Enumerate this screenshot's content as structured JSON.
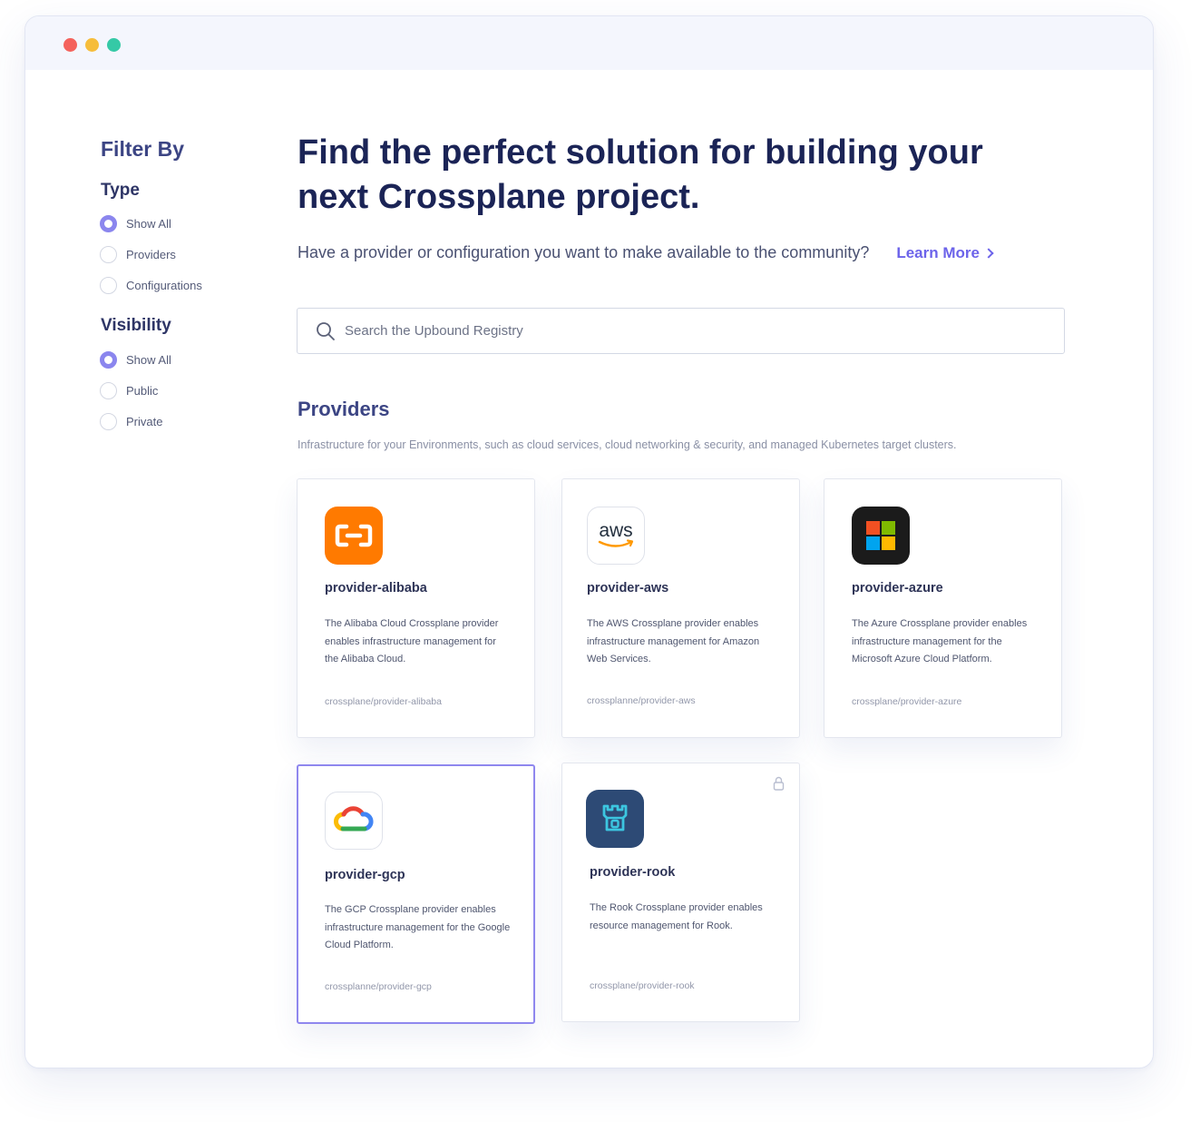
{
  "window": {
    "controls": [
      "close",
      "minimize",
      "maximize"
    ]
  },
  "filters": {
    "title": "Filter By",
    "type": {
      "title": "Type",
      "options": [
        {
          "label": "Show All",
          "checked": true
        },
        {
          "label": "Providers",
          "checked": false
        },
        {
          "label": "Configurations",
          "checked": false
        }
      ]
    },
    "visibility": {
      "title": "Visibility",
      "options": [
        {
          "label": "Show All",
          "checked": true
        },
        {
          "label": "Public",
          "checked": false
        },
        {
          "label": "Private",
          "checked": false
        }
      ]
    }
  },
  "main": {
    "headline": "Find the perfect solution for building your next Crossplane project.",
    "subtext": "Have a provider or configuration you want to make available to the community?",
    "learn_more": "Learn More",
    "search": {
      "placeholder": "Search the Upbound Registry",
      "value": ""
    },
    "section": {
      "title": "Providers",
      "description": "Infrastructure for your Environments, such as cloud services, cloud networking & security, and managed Kubernetes target clusters."
    },
    "cards": [
      {
        "name": "provider-alibaba",
        "description": "The Alibaba Cloud Crossplane provider enables infrastructure management for the Alibaba Cloud.",
        "path": "crossplane/provider-alibaba",
        "icon": "alibaba-cloud-logo",
        "selected": false,
        "locked": false
      },
      {
        "name": "provider-aws",
        "description": "The AWS Crossplane provider enables infrastructure management for Amazon Web Services.",
        "path": "crossplanne/provider-aws",
        "icon": "aws-logo",
        "logo_text": "aws",
        "selected": false,
        "locked": false
      },
      {
        "name": "provider-azure",
        "description": "The Azure Crossplane provider enables infrastructure management for the Microsoft Azure Cloud Platform.",
        "path": "crossplane/provider-azure",
        "icon": "microsoft-azure-logo",
        "selected": false,
        "locked": false
      },
      {
        "name": "provider-gcp",
        "description": "The GCP Crossplane provider enables infrastructure management for the Google Cloud Platform.",
        "path": "crossplanne/provider-gcp",
        "icon": "google-cloud-logo",
        "selected": true,
        "locked": false
      },
      {
        "name": "provider-rook",
        "description": "The Rook Crossplane provider enables resource management for Rook.",
        "path": "crossplane/provider-rook",
        "icon": "rook-logo",
        "selected": false,
        "locked": true
      }
    ]
  },
  "colors": {
    "accent": "#6c63ea",
    "radio_checked": "#8b86ee",
    "heading": "#1b2456",
    "dot_close": "#f4625c",
    "dot_minimize": "#f6bd3b",
    "dot_maximize": "#35c9a6"
  }
}
